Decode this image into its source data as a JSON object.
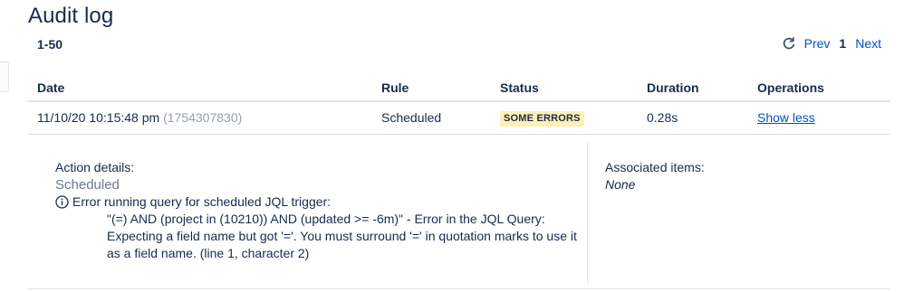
{
  "page": {
    "title": "Audit log",
    "range": "1-50"
  },
  "pagination": {
    "refresh_icon": "refresh-icon",
    "prev_label": "Prev",
    "current_page": "1",
    "next_label": "Next"
  },
  "table": {
    "headers": {
      "date": "Date",
      "rule": "Rule",
      "status": "Status",
      "duration": "Duration",
      "operations": "Operations"
    },
    "rows": [
      {
        "date": "11/10/20 10:15:48 pm",
        "id": "(1754307830)",
        "rule": "Scheduled",
        "status": "SOME ERRORS",
        "status_color": "#fff0b3",
        "duration": "0.28s",
        "operation": "Show less"
      }
    ]
  },
  "details": {
    "action_label": "Action details:",
    "action_value": "Scheduled",
    "error_icon": "info-icon",
    "error_title": "Error running query for scheduled JQL trigger:",
    "error_detail": "\"(=) AND (project in (10210)) AND (updated >= -6m)\" - Error in the JQL Query: Expecting a field name but got '='. You must surround '=' in quotation marks to use it as a field name. (line 1, character 2)",
    "associated_label": "Associated items:",
    "associated_value": "None"
  }
}
